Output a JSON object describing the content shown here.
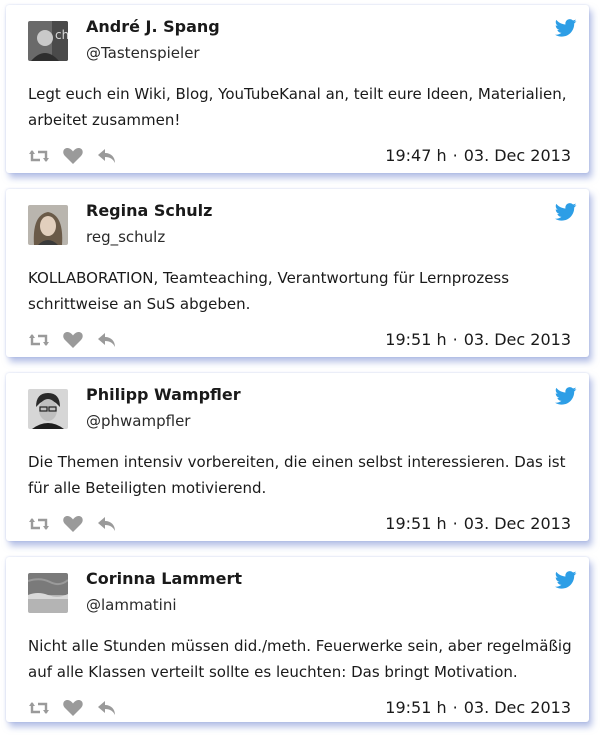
{
  "colors": {
    "twitter_blue": "#2d9ee6",
    "action_gray": "#9a9a9a",
    "card_shadow": "#7f93d6"
  },
  "tweets": [
    {
      "name": "André J. Spang",
      "handle": "@Tastenspieler",
      "text": "Legt euch ein Wiki, Blog, YouTubeKanal an, teilt eure Ideen, Materialien, arbeitet zusammen!",
      "time": "19:47 h",
      "separator": "·",
      "date": "03. Dec 2013"
    },
    {
      "name": "Regina Schulz",
      "handle": "reg_schulz",
      "text": "KOLLABORATION, Teamteaching, Verantwortung für Lernprozess schrittweise an SuS abgeben.",
      "time": "19:51 h",
      "separator": "·",
      "date": "03. Dec 2013"
    },
    {
      "name": "Philipp Wampfler",
      "handle": "@phwampfler",
      "text": "Die Themen intensiv vorbereiten, die einen selbst interessieren. Das ist für alle Beteiligten motivierend.",
      "time": "19:51 h",
      "separator": "·",
      "date": "03. Dec 2013"
    },
    {
      "name": "Corinna Lammert",
      "handle": "@lammatini",
      "text": "Nicht alle Stunden müssen did./meth. Feuerwerke sein, aber regelmäßig auf alle Klassen verteilt sollte es leuchten: Das bringt Motivation.",
      "time": "19:51 h",
      "separator": "·",
      "date": "03. Dec 2013"
    }
  ],
  "icons": [
    "twitter-bird-icon",
    "retweet-icon",
    "heart-icon",
    "reply-icon"
  ]
}
